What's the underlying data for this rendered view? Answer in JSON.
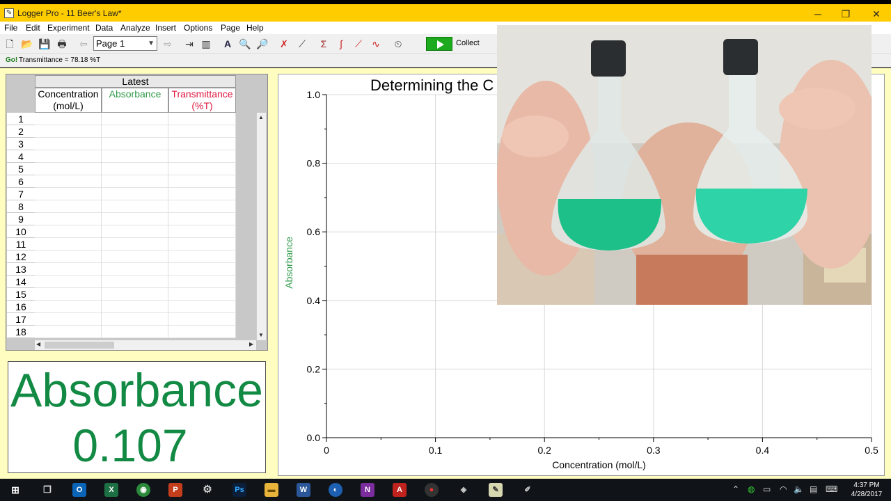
{
  "window": {
    "title": "Logger Pro - 11 Beer's Law*",
    "minimize": "─",
    "maximize": "❐",
    "close": "✕"
  },
  "menu": [
    "File",
    "Edit",
    "Experiment",
    "Data",
    "Analyze",
    "Insert",
    "Options",
    "Page",
    "Help"
  ],
  "toolbar": {
    "page_select": "Page 1",
    "collect_label": "Collect"
  },
  "status": {
    "go_label": "Go!",
    "reading": "Transmittance = 78.18 %T"
  },
  "table": {
    "group_header": "Latest",
    "columns": [
      {
        "label": "Concentration",
        "unit": "(mol/L)",
        "color": "#000000"
      },
      {
        "label": "Absorbance",
        "unit": "",
        "color": "#2e9a4a"
      },
      {
        "label": "Transmittance",
        "unit": "(%T)",
        "color": "#e0173f"
      }
    ],
    "rows": [
      "1",
      "2",
      "3",
      "4",
      "5",
      "6",
      "7",
      "8",
      "9",
      "10",
      "11",
      "12",
      "13",
      "14",
      "15",
      "16",
      "17",
      "18"
    ]
  },
  "meter": {
    "label": "Absorbance",
    "value": "0.107",
    "color": "#128a44"
  },
  "chart_data": {
    "type": "scatter",
    "title": "Determining the C",
    "xlabel": "Concentration (mol/L)",
    "ylabel": "Absorbance",
    "xlim": [
      0,
      0.5
    ],
    "ylim": [
      0,
      1.0
    ],
    "x_ticks": [
      "0",
      "0.1",
      "0.2",
      "0.3",
      "0.4",
      "0.5"
    ],
    "y_ticks": [
      "0.0",
      "0.2",
      "0.4",
      "0.6",
      "0.8",
      "1.0"
    ],
    "grid": true,
    "series": []
  },
  "taskbar": {
    "clock_time": "4:37 PM",
    "clock_date": "4/28/2017"
  }
}
